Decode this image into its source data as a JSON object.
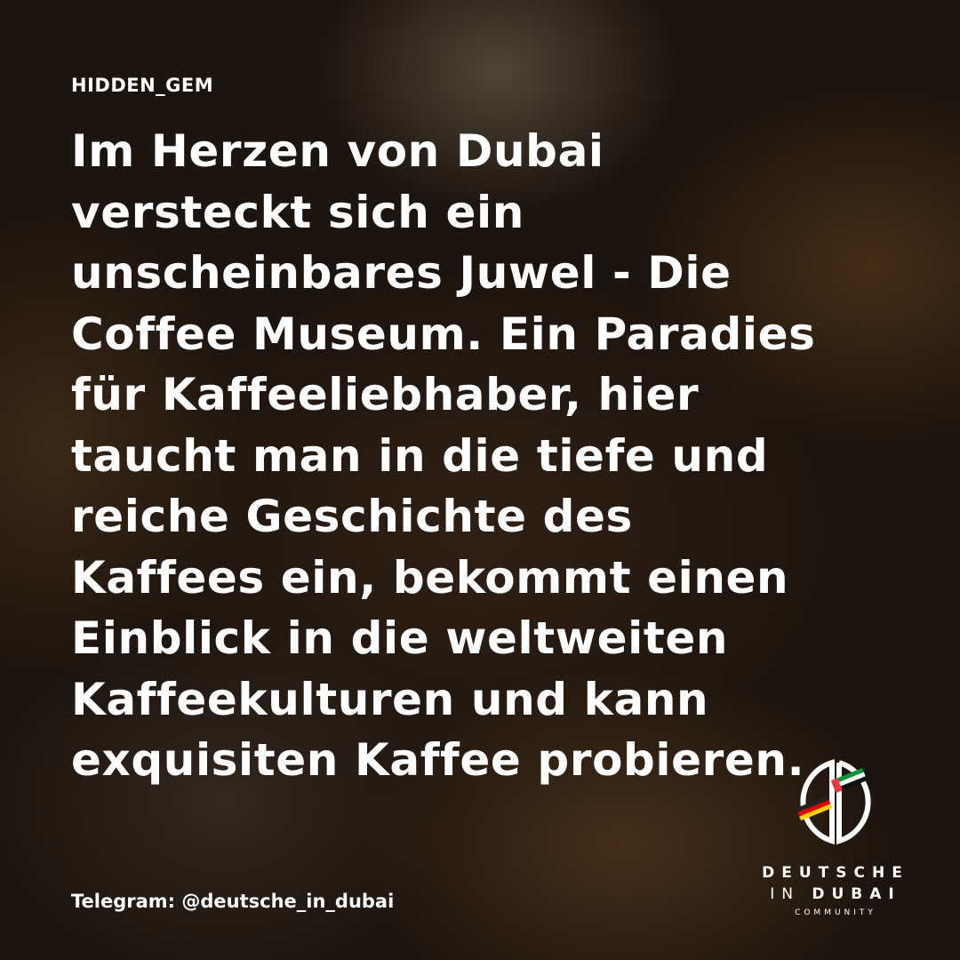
{
  "tag": "HIDDEN_GEM",
  "headline": [
    "Im Herzen von Dubai",
    "versteckt sich ein",
    "unscheinbares Juwel - Die",
    "Coffee Museum. Ein Paradies",
    "für Kaffeeliebhaber, hier",
    "taucht man in die tiefe und",
    "reiche Geschichte des",
    "Kaffees ein, bekommt einen",
    "Einblick in die weltweiten",
    "Kaffeekulturen und kann",
    "exquisiten Kaffee probieren."
  ],
  "footer": "Telegram: @deutsche_in_dubai",
  "logo": {
    "line1": "DEUTSCHE",
    "line2a": "IN",
    "line2b": "DUBAI",
    "line3": "COMMUNITY"
  }
}
